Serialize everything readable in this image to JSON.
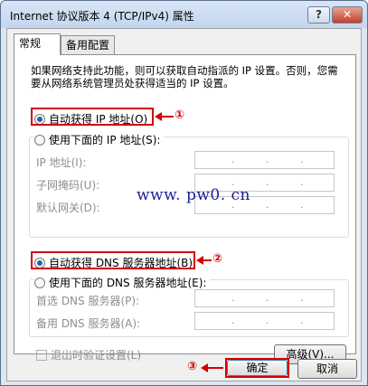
{
  "window": {
    "title": "Internet 协议版本 4 (TCP/IPv4) 属性",
    "help_label": "?",
    "close_label": "✕"
  },
  "tabs": [
    {
      "label": "常规",
      "selected": true
    },
    {
      "label": "备用配置",
      "selected": false
    }
  ],
  "general": {
    "description": "如果网络支持此功能，则可以获取自动指派的 IP 设置。否则，您需要从网络系统管理员处获得适当的 IP 设置。",
    "auto_ip_label": "自动获得 IP 地址(O)",
    "manual_ip_label": "使用下面的 IP 地址(S):",
    "ip_fields": [
      {
        "label": "IP 地址(I):"
      },
      {
        "label": "子网掩码(U):"
      },
      {
        "label": "默认网关(D):"
      }
    ],
    "auto_dns_label": "自动获得 DNS 服务器地址(B)",
    "manual_dns_label": "使用下面的 DNS 服务器地址(E):",
    "dns_fields": [
      {
        "label": "首选 DNS 服务器(P):"
      },
      {
        "label": "备用 DNS 服务器(A):"
      }
    ],
    "validate_label": "退出时验证设置(L)",
    "advanced_label": "高级(V)..."
  },
  "buttons": {
    "ok_label": "确定",
    "cancel_label": "取消"
  },
  "annotations": {
    "marker_1": "①",
    "marker_2": "②",
    "marker_3": "③",
    "watermark": "www. pw0. cn"
  },
  "colors": {
    "annotation_red": "#d40000",
    "watermark_blue": "#1b1b9b"
  }
}
